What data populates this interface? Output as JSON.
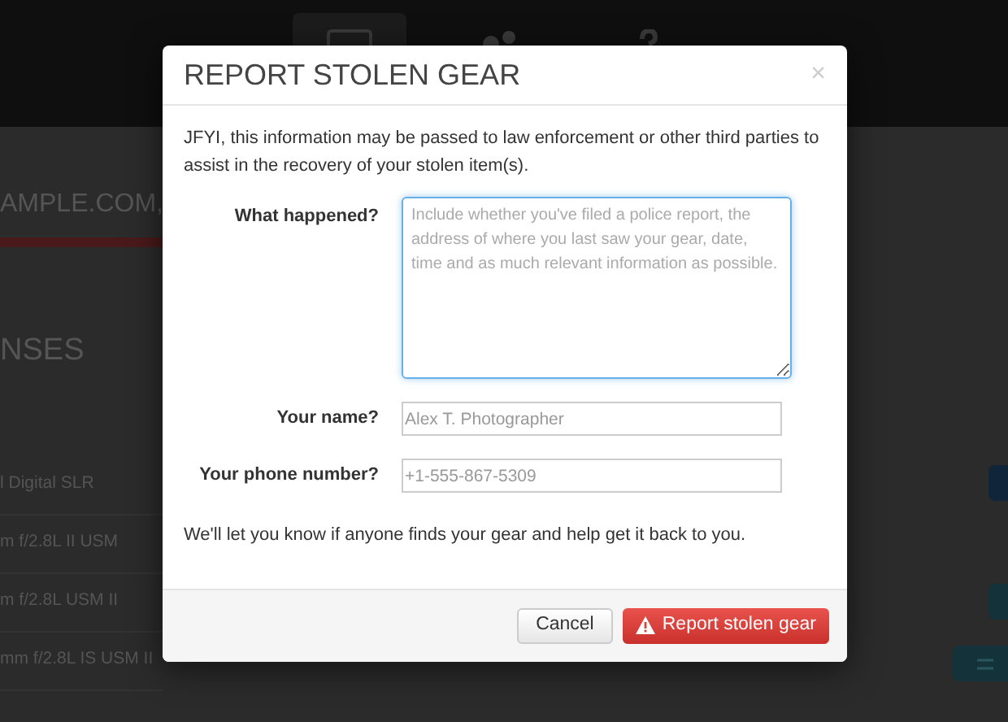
{
  "background": {
    "nav_tabs": [
      {
        "selected": true
      },
      {
        "selected": false
      },
      {
        "selected": false
      }
    ],
    "site_title": "AMPLE.COM,",
    "section_title": "NSES",
    "items": [
      "l Digital SLR",
      "m f/2.8L II USM",
      "m f/2.8L USM II",
      "mm f/2.8L IS USM II"
    ]
  },
  "modal": {
    "title": "REPORT STOLEN GEAR",
    "close": "×",
    "intro": "JFYI, this information may be passed to law enforcement or other third parties to assist in the recovery of your stolen item(s).",
    "fields": [
      {
        "kind": "textarea",
        "label": "What happened?",
        "placeholder": "Include whether you've filed a police report, the address of where you last saw your gear, date, time and as much relevant information as possible."
      },
      {
        "kind": "input",
        "label": "Your name?",
        "placeholder": "Alex T. Photographer"
      },
      {
        "kind": "input",
        "label": "Your phone number?",
        "placeholder": "+1-555-867-5309"
      }
    ],
    "note": "We'll let you know if anyone finds your gear and help get it back to you.",
    "buttons": [
      {
        "kind": "default",
        "label": "Cancel"
      },
      {
        "kind": "danger",
        "label": "Report stolen gear"
      }
    ]
  }
}
